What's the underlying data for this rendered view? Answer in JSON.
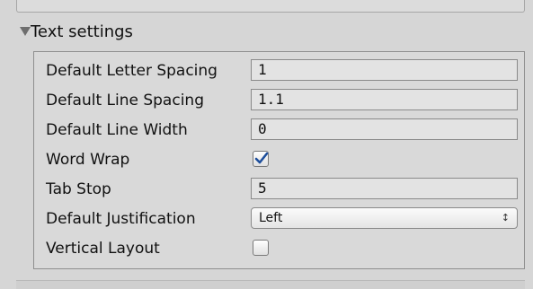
{
  "section": {
    "title": "Text settings",
    "expanded": true
  },
  "fields": [
    {
      "label": "Default Letter Spacing",
      "value": "1"
    },
    {
      "label": "Default Line Spacing",
      "value": "1.1"
    },
    {
      "label": "Default Line Width",
      "value": "0"
    },
    {
      "label": "Word Wrap",
      "checked": true
    },
    {
      "label": "Tab Stop",
      "value": "5"
    },
    {
      "label": "Default Justification",
      "selected": "Left"
    },
    {
      "label": "Vertical Layout",
      "checked": false
    }
  ],
  "colors": {
    "checkmark": "#1e4f9c",
    "panel_border": "#8f8f8f",
    "field_bg": "#e3e3e3"
  },
  "icons": {
    "disclosure": "triangle-down-icon",
    "checkmark": "checkmark-icon",
    "dropdown": "up-down-arrows-icon"
  }
}
